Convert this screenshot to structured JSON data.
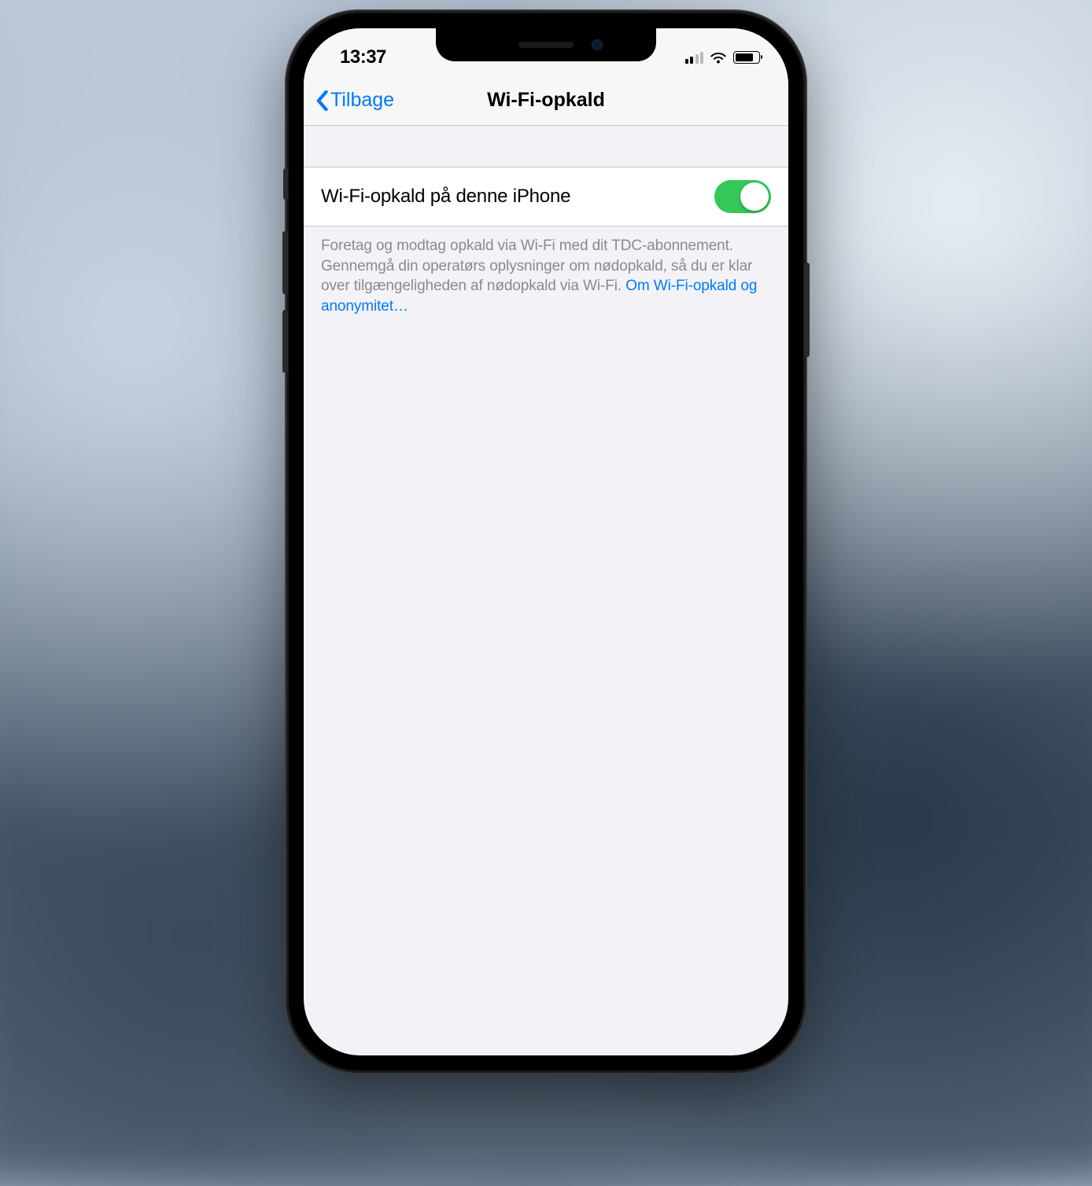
{
  "status_bar": {
    "time": "13:37"
  },
  "nav": {
    "back_label": "Tilbage",
    "title": "Wi-Fi-opkald"
  },
  "setting": {
    "label": "Wi-Fi-opkald på denne iPhone",
    "enabled": true
  },
  "footer": {
    "text": "Foretag og modtag opkald via Wi-Fi med dit TDC-abonnement. Gennemgå din operatørs oplysninger om nødopkald, så du er klar over tilgængeligheden af nødopkald via Wi-Fi. ",
    "link": "Om Wi-Fi-opkald og anonymitet…"
  },
  "colors": {
    "accent": "#007aff",
    "toggle_on": "#34c759",
    "bg": "#f2f2f7"
  }
}
